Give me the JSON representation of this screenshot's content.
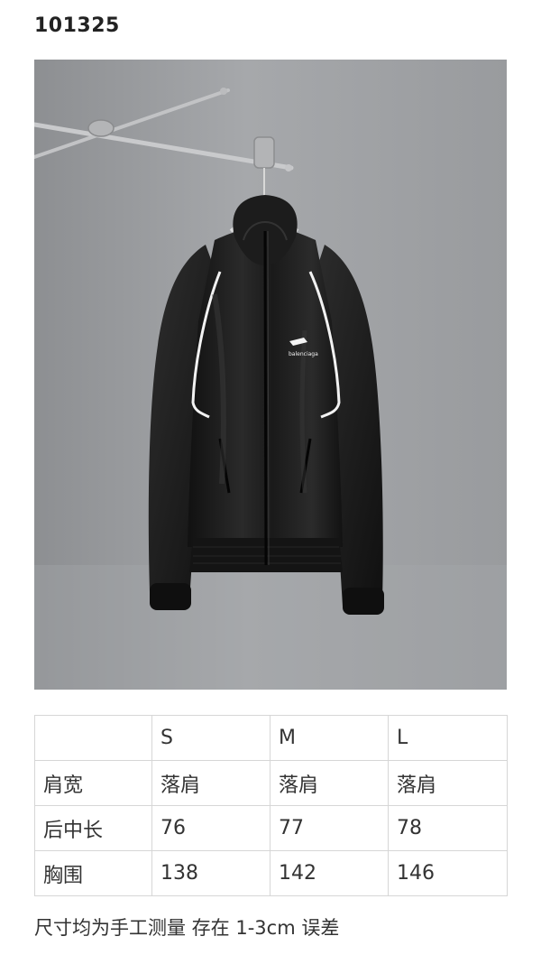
{
  "product_code": "101325",
  "photo": {
    "subject": "black-zip-hooded-jacket-image",
    "logo_text": "balenciaga"
  },
  "size_table": {
    "header": [
      "",
      "S",
      "M",
      "L"
    ],
    "rows": [
      {
        "label": "肩宽",
        "values": [
          "落肩",
          "落肩",
          "落肩"
        ]
      },
      {
        "label": "后中长",
        "values": [
          "76",
          "77",
          "78"
        ]
      },
      {
        "label": "胸围",
        "values": [
          "138",
          "142",
          "146"
        ]
      }
    ]
  },
  "note": "尺寸均为手工测量 存在 1-3cm 误差",
  "colors": {
    "background": "#ffffff",
    "photo_backdrop": "#9a9c9f",
    "jacket": "#1a1a1a",
    "piping": "#f2f2f2"
  }
}
